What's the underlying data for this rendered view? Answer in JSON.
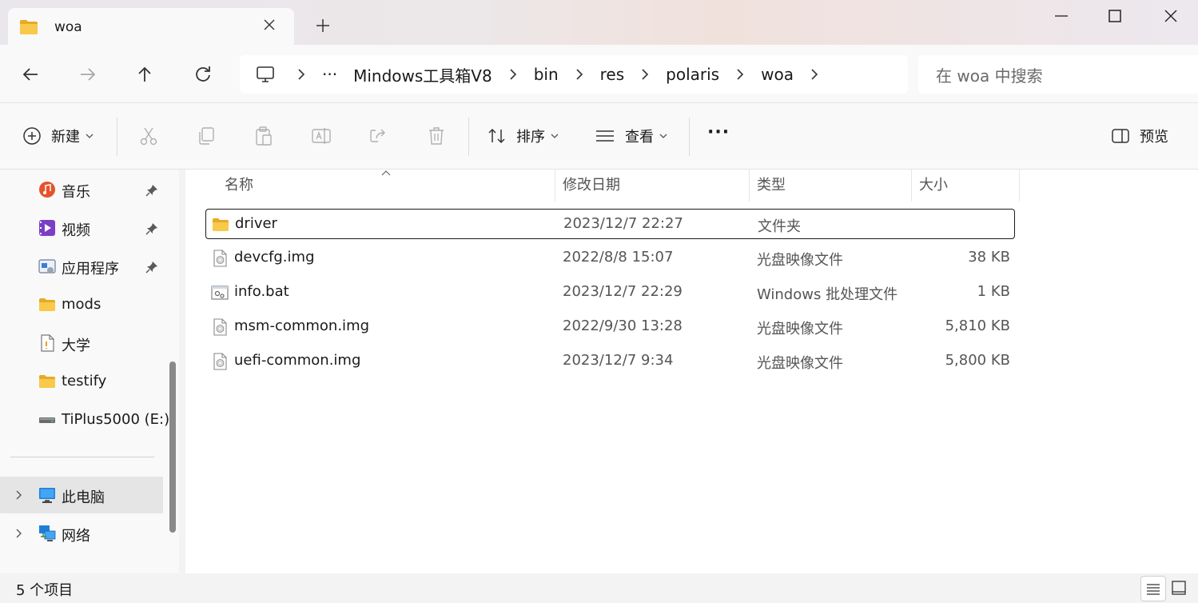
{
  "tab": {
    "title": "woa"
  },
  "breadcrumb": {
    "overflow": "···",
    "items": [
      "Mindows工具箱V8",
      "bin",
      "res",
      "polaris",
      "woa"
    ]
  },
  "search": {
    "placeholder": "在 woa 中搜索"
  },
  "toolbar": {
    "new_label": "新建",
    "sort_label": "排序",
    "view_label": "查看",
    "more_label": "···",
    "preview_label": "预览"
  },
  "sidebar": {
    "items": [
      {
        "label": "音乐",
        "icon": "music-icon",
        "pinned": true
      },
      {
        "label": "视频",
        "icon": "video-icon",
        "pinned": true
      },
      {
        "label": "应用程序",
        "icon": "app-icon",
        "pinned": true
      },
      {
        "label": "mods",
        "icon": "folder-icon",
        "pinned": false
      },
      {
        "label": "大学",
        "icon": "document-icon",
        "pinned": false
      },
      {
        "label": "testify",
        "icon": "folder-icon",
        "pinned": false
      },
      {
        "label": "TiPlus5000 (E:)",
        "icon": "drive-icon",
        "pinned": false
      }
    ],
    "roots": [
      {
        "label": "此电脑",
        "icon": "computer-icon"
      },
      {
        "label": "网络",
        "icon": "network-icon"
      }
    ]
  },
  "columns": {
    "name": "名称",
    "date": "修改日期",
    "type": "类型",
    "size": "大小"
  },
  "files": [
    {
      "name": "driver",
      "date": "2023/12/7 22:27",
      "type": "文件夹",
      "size": "",
      "icon": "folder-icon"
    },
    {
      "name": "devcfg.img",
      "date": "2022/8/8 15:07",
      "type": "光盘映像文件",
      "size": "38 KB",
      "icon": "disc-image-icon"
    },
    {
      "name": "info.bat",
      "date": "2023/12/7 22:29",
      "type": "Windows 批处理文件",
      "size": "1 KB",
      "icon": "batch-file-icon"
    },
    {
      "name": "msm-common.img",
      "date": "2022/9/30 13:28",
      "type": "光盘映像文件",
      "size": "5,810 KB",
      "icon": "disc-image-icon"
    },
    {
      "name": "uefi-common.img",
      "date": "2023/12/7 9:34",
      "type": "光盘映像文件",
      "size": "5,800 KB",
      "icon": "disc-image-icon"
    }
  ],
  "status": {
    "count": "5 个项目"
  },
  "colors": {
    "folder": "#f5c342",
    "accent": "#0067c0",
    "selected_row_border": "#1a1a1a"
  }
}
